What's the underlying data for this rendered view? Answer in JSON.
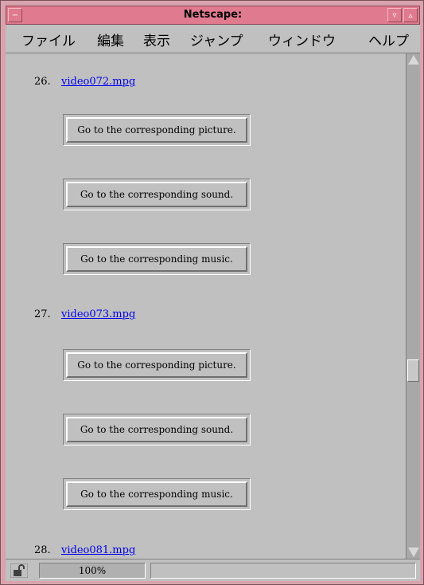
{
  "window": {
    "title": "Netscape:"
  },
  "menu": [
    "ファイル",
    "編集",
    "表示",
    "ジャンプ",
    "ウィンドウ",
    "ヘルプ"
  ],
  "entries": [
    {
      "number": "26.",
      "link": "video072.mpg",
      "buttons": [
        "Go to the corresponding picture.",
        "Go to the corresponding sound.",
        "Go to the corresponding music."
      ]
    },
    {
      "number": "27.",
      "link": "video073.mpg",
      "buttons": [
        "Go to the corresponding picture.",
        "Go to the corresponding sound.",
        "Go to the corresponding music."
      ]
    },
    {
      "number": "28.",
      "link": "video081.mpg",
      "buttons": []
    }
  ],
  "status": {
    "zoom": "100%"
  },
  "colors": {
    "titlebar": "#e07a8e",
    "frame": "#d9a3ad",
    "page_bg": "#c0c0c0",
    "link": "#0000ee"
  },
  "icons": [
    "window-menu-icon",
    "minimize-icon",
    "maximize-icon",
    "scroll-up-arrow-icon",
    "scroll-down-arrow-icon",
    "security-lock-icon"
  ]
}
